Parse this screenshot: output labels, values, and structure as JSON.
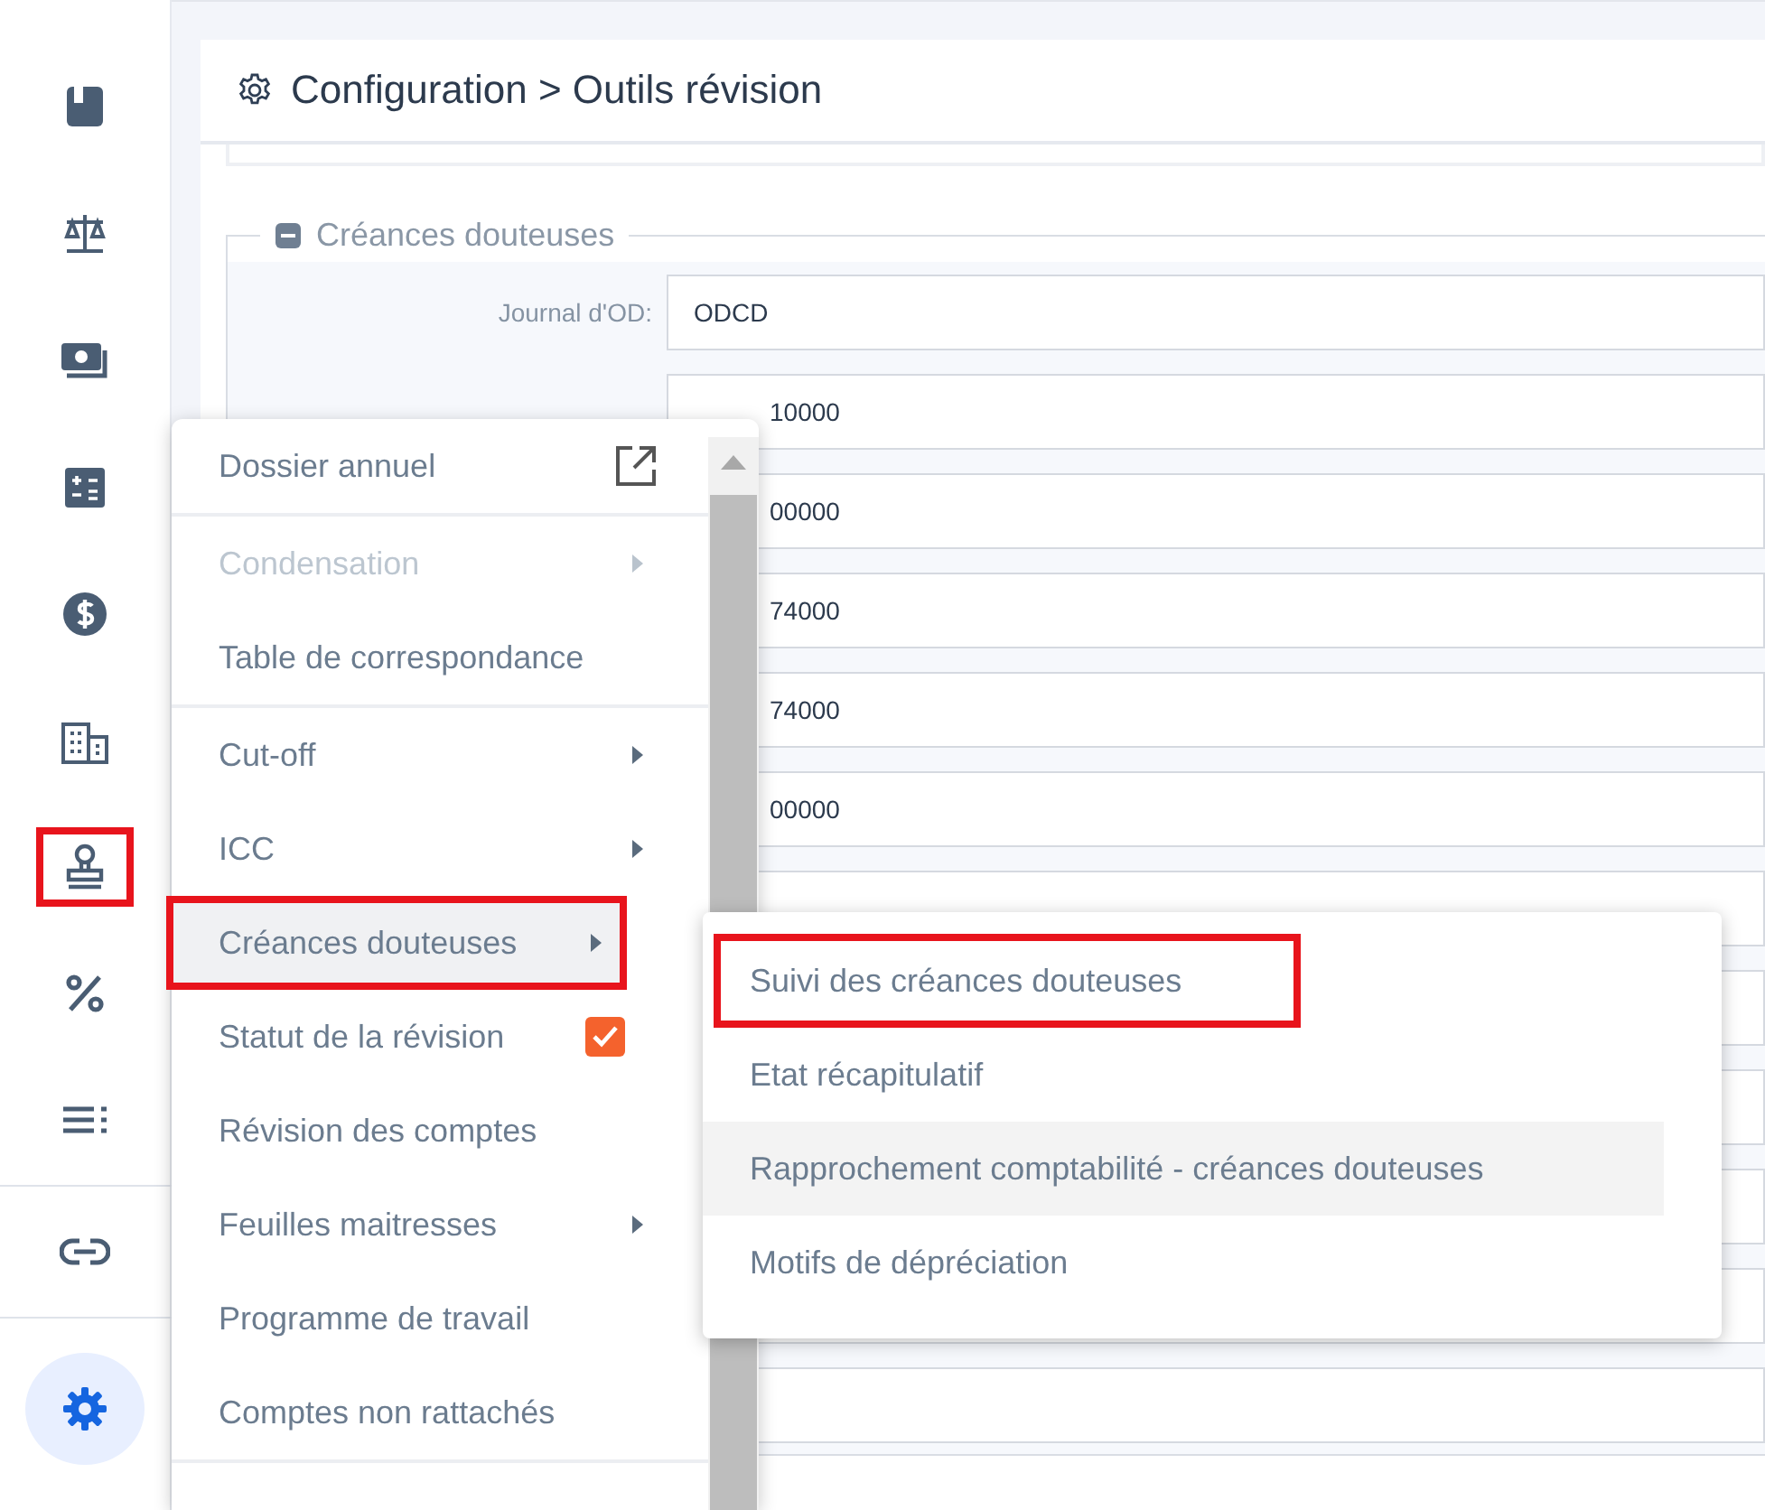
{
  "sidebar": {
    "items": [
      {
        "selected": false,
        "annotated": false
      },
      {
        "selected": false,
        "annotated": false
      },
      {
        "selected": false,
        "annotated": false
      },
      {
        "selected": false,
        "annotated": false
      },
      {
        "selected": false,
        "annotated": false
      },
      {
        "selected": false,
        "annotated": false
      },
      {
        "selected": false,
        "annotated": true
      },
      {
        "selected": false,
        "annotated": false
      },
      {
        "selected": false,
        "annotated": false
      },
      {
        "selected": false,
        "annotated": false
      },
      {
        "selected": true,
        "annotated": false
      }
    ]
  },
  "header": {
    "title": "Configuration > Outils révision"
  },
  "section": {
    "title": "Créances douteuses",
    "expanded": true,
    "fields": [
      {
        "label": "Journal d'OD:",
        "value": "ODCD"
      },
      {
        "value": "10000"
      },
      {
        "value": "00000"
      },
      {
        "value": "74000"
      },
      {
        "value": "74000"
      },
      {
        "value": "00000"
      }
    ]
  },
  "menu": {
    "groups": [
      {
        "items": [
          {
            "label": "Dossier annuel",
            "kind": "link",
            "disabled": false,
            "hovered": false,
            "annotated": false
          }
        ]
      },
      {
        "items": [
          {
            "label": "Condensation",
            "kind": "submenu",
            "disabled": true,
            "hovered": false,
            "annotated": false
          },
          {
            "label": "Table de correspondance",
            "kind": "plain",
            "disabled": false,
            "hovered": false,
            "annotated": false
          }
        ]
      },
      {
        "items": [
          {
            "label": "Cut-off",
            "kind": "submenu",
            "disabled": false,
            "hovered": false,
            "annotated": false
          },
          {
            "label": "ICC",
            "kind": "submenu",
            "disabled": false,
            "hovered": false,
            "annotated": false
          },
          {
            "label": "Créances douteuses",
            "kind": "submenu",
            "disabled": false,
            "hovered": true,
            "annotated": true
          },
          {
            "label": "Statut de la révision",
            "kind": "checkbox",
            "checked": true,
            "disabled": false,
            "hovered": false,
            "annotated": false
          },
          {
            "label": "Révision des comptes",
            "kind": "plain",
            "disabled": false,
            "hovered": false,
            "annotated": false
          },
          {
            "label": "Feuilles maitresses",
            "kind": "submenu",
            "disabled": false,
            "hovered": false,
            "annotated": false
          },
          {
            "label": "Programme de travail",
            "kind": "plain",
            "disabled": false,
            "hovered": false,
            "annotated": false
          },
          {
            "label": "Comptes non rattachés",
            "kind": "plain",
            "disabled": false,
            "hovered": false,
            "annotated": false
          }
        ]
      }
    ]
  },
  "submenu": {
    "items": [
      {
        "label": "Suivi des créances douteuses",
        "hovered": false,
        "annotated": true
      },
      {
        "label": "Etat récapitulatif",
        "hovered": false,
        "annotated": false
      },
      {
        "label": "Rapprochement comptabilité - créances douteuses",
        "hovered": true,
        "annotated": false
      },
      {
        "label": "Motifs de dépréciation",
        "hovered": false,
        "annotated": false
      }
    ]
  }
}
